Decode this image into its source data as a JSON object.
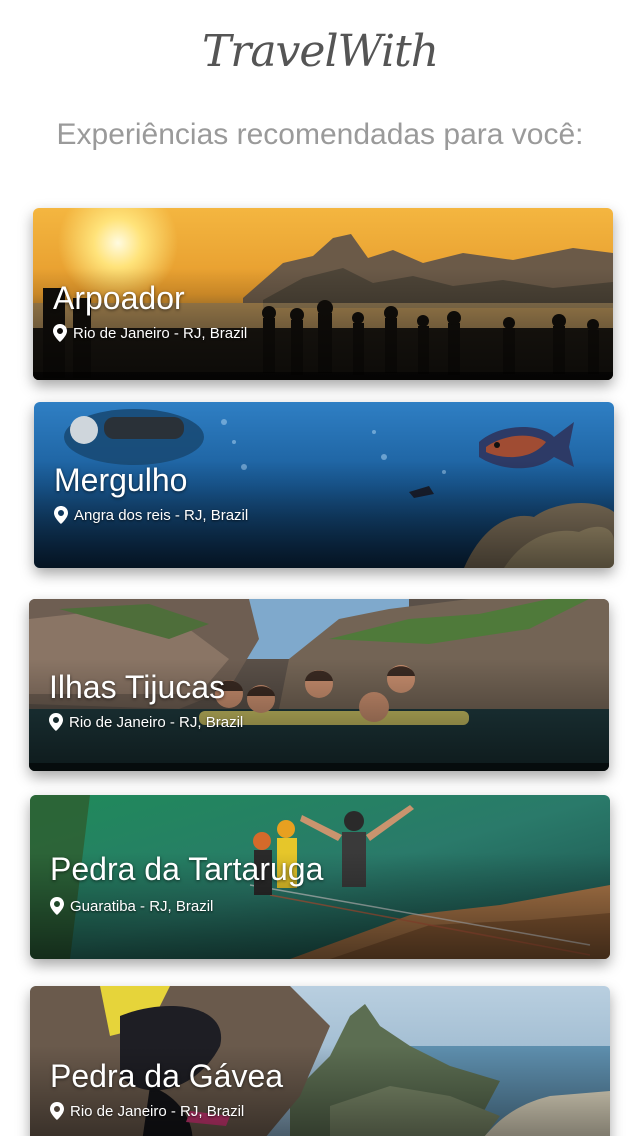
{
  "app": {
    "logo": "TravelWith",
    "subtitle": "Experiências recomendadas para você:"
  },
  "icons": {
    "location": "map-pin-icon"
  },
  "experiences": [
    {
      "title": "Arpoador",
      "location": "Rio de Janeiro - RJ, Brazil",
      "theme": "sunset-beach"
    },
    {
      "title": "Mergulho",
      "location": "Angra dos reis - RJ, Brazil",
      "theme": "underwater"
    },
    {
      "title": "Ilhas Tijucas",
      "location": "Rio de Janeiro - RJ, Brazil",
      "theme": "rocky-islands"
    },
    {
      "title": "Pedra da Tartaruga",
      "location": "Guaratiba - RJ, Brazil",
      "theme": "rappel-green-sea"
    },
    {
      "title": "Pedra da Gávea",
      "location": "Rio de Janeiro - RJ, Brazil",
      "theme": "mountain-view"
    }
  ],
  "colors": {
    "logo": "#555555",
    "subtitle": "#9a9a9a",
    "card_text": "#ffffff"
  }
}
